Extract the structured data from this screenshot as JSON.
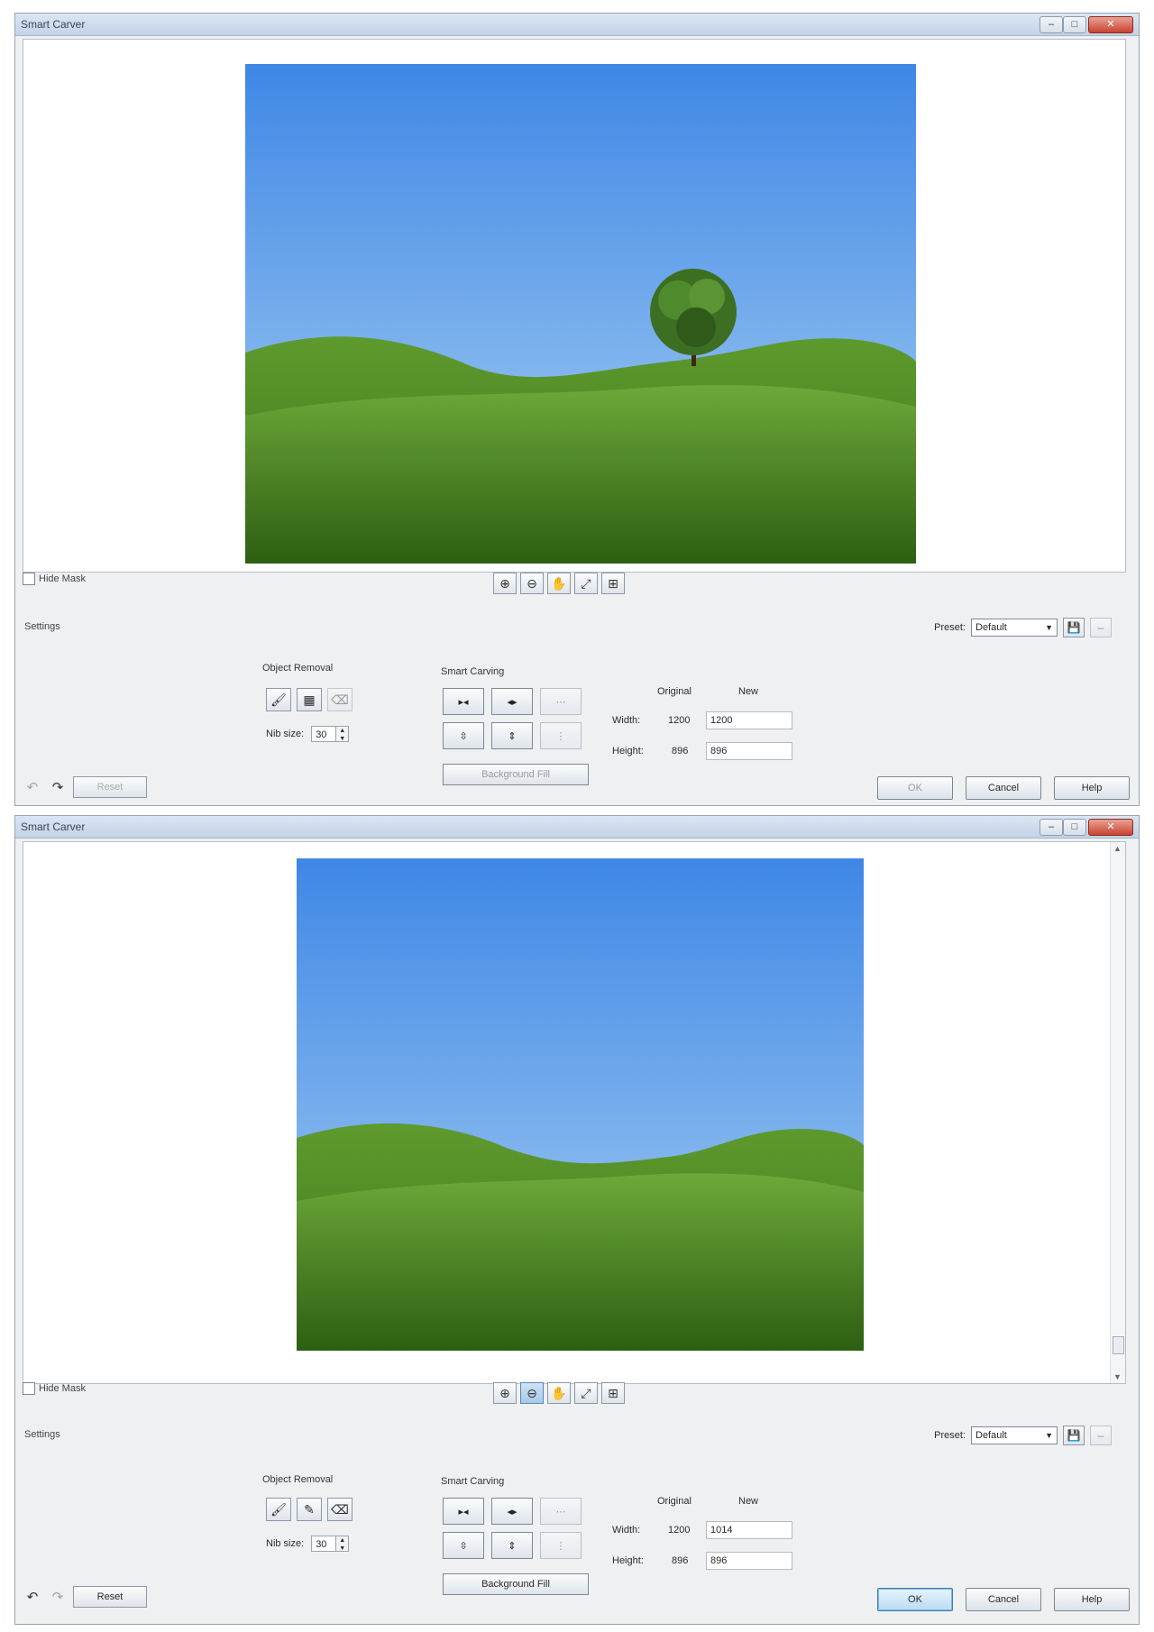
{
  "windows": [
    {
      "title": "Smart Carver",
      "hide_mask_label": "Hide Mask",
      "settings_label": "Settings",
      "preset_label": "Preset:",
      "preset_value": "Default",
      "object_removal_title": "Object Removal",
      "nib_size_label": "Nib size:",
      "nib_size_value": "30",
      "smart_carving_title": "Smart Carving",
      "background_fill_label": "Background Fill",
      "original_header": "Original",
      "new_header": "New",
      "width_label": "Width:",
      "height_label": "Height:",
      "width_original": "1200",
      "width_new": "1200",
      "height_original": "896",
      "height_new": "896",
      "reset_label": "Reset",
      "ok_label": "OK",
      "cancel_label": "Cancel",
      "help_label": "Help"
    },
    {
      "title": "Smart Carver",
      "hide_mask_label": "Hide Mask",
      "settings_label": "Settings",
      "preset_label": "Preset:",
      "preset_value": "Default",
      "object_removal_title": "Object Removal",
      "nib_size_label": "Nib size:",
      "nib_size_value": "30",
      "smart_carving_title": "Smart Carving",
      "background_fill_label": "Background Fill",
      "original_header": "Original",
      "new_header": "New",
      "width_label": "Width:",
      "height_label": "Height:",
      "width_original": "1200",
      "width_new": "1014",
      "height_original": "896",
      "height_new": "896",
      "reset_label": "Reset",
      "ok_label": "OK",
      "cancel_label": "Cancel",
      "help_label": "Help"
    }
  ],
  "colors": {
    "sky_top": "#3f87e6",
    "sky_bottom": "#a9d1f2",
    "grass_light": "#6ea83a",
    "grass_dark": "#2d5f12",
    "tree": "#3d6f22",
    "default_button": "#3c7fb1"
  },
  "icons": [
    "zoom-in-icon",
    "zoom-out-icon",
    "pan-hand-icon",
    "zoom-fit-icon",
    "actual-size-icon",
    "brush-icon",
    "eraser-icon",
    "save-preset-icon",
    "undo-icon",
    "redo-icon"
  ]
}
